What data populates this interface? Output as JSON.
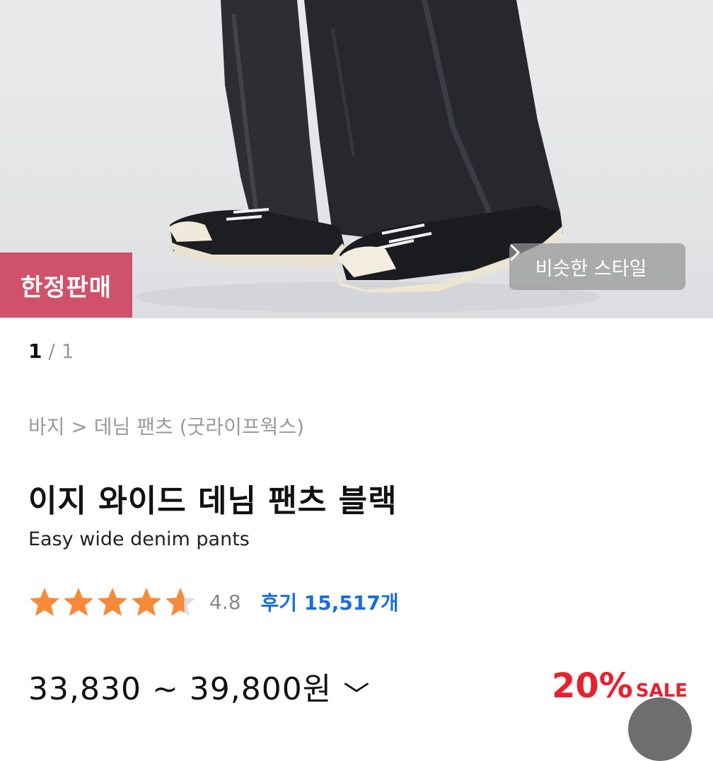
{
  "badges": {
    "limited": "한정판매"
  },
  "similar_style": {
    "label": "비슷한 스타일",
    "icon": "chevron-right-icon"
  },
  "gallery": {
    "current": "1",
    "separator": " / ",
    "total": "1"
  },
  "breadcrumb": "바지 > 데님 팬츠 (굿라이프웍스)",
  "product": {
    "title": "이지 와이드 데님 팬츠 블랙",
    "subtitle": "Easy wide denim pants",
    "rating": "4.8",
    "rating_value": 4.8,
    "reviews": "후기 15,517개",
    "price": "33,830 ~ 39,800원",
    "discount_pct": "20%",
    "discount_label": "SALE"
  },
  "colors": {
    "badge": "#d0526a",
    "star": "#f7893a",
    "review_link": "#1a6fd8",
    "discount": "#e8212e"
  }
}
